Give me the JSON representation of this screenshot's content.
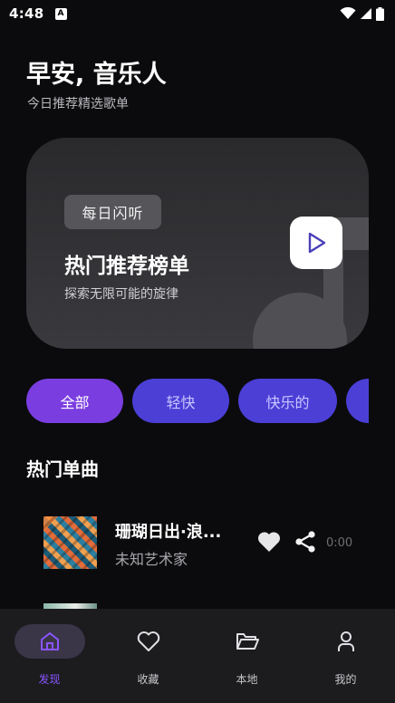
{
  "status_bar": {
    "time": "4:48",
    "notification_icon": "A",
    "icons": [
      "wifi-icon",
      "signal-icon",
      "battery-icon"
    ]
  },
  "header": {
    "greeting": "早安, 音乐人",
    "subtitle": "今日推荐精选歌单"
  },
  "hero_card": {
    "tag": "每日闪听",
    "title": "热门推荐榜单",
    "description": "探索无限可能的旋律",
    "play_icon": "play-icon",
    "decoration_icon": "music-note-icon"
  },
  "categories": [
    {
      "label": "全部",
      "active": true
    },
    {
      "label": "轻快",
      "active": false
    },
    {
      "label": "快乐的",
      "active": false
    },
    {
      "label": "",
      "active": false
    }
  ],
  "section": {
    "title": "热门单曲"
  },
  "songs": [
    {
      "title": "珊瑚日出·浪...",
      "artist": "未知艺术家",
      "duration": "0:00",
      "like_icon": "heart-icon",
      "share_icon": "share-icon"
    }
  ],
  "bottom_nav": [
    {
      "label": "发现",
      "icon": "home-icon",
      "active": true
    },
    {
      "label": "收藏",
      "icon": "heart-outline-icon",
      "active": false
    },
    {
      "label": "本地",
      "icon": "folder-icon",
      "active": false
    },
    {
      "label": "我的",
      "icon": "user-icon",
      "active": false
    }
  ],
  "colors": {
    "background": "#0b0b0d",
    "accent_active": "#7a3ee0",
    "chip": "#4b3fd6",
    "nav_active": "#8a55ff",
    "nav_bg": "#1c1c1f"
  }
}
